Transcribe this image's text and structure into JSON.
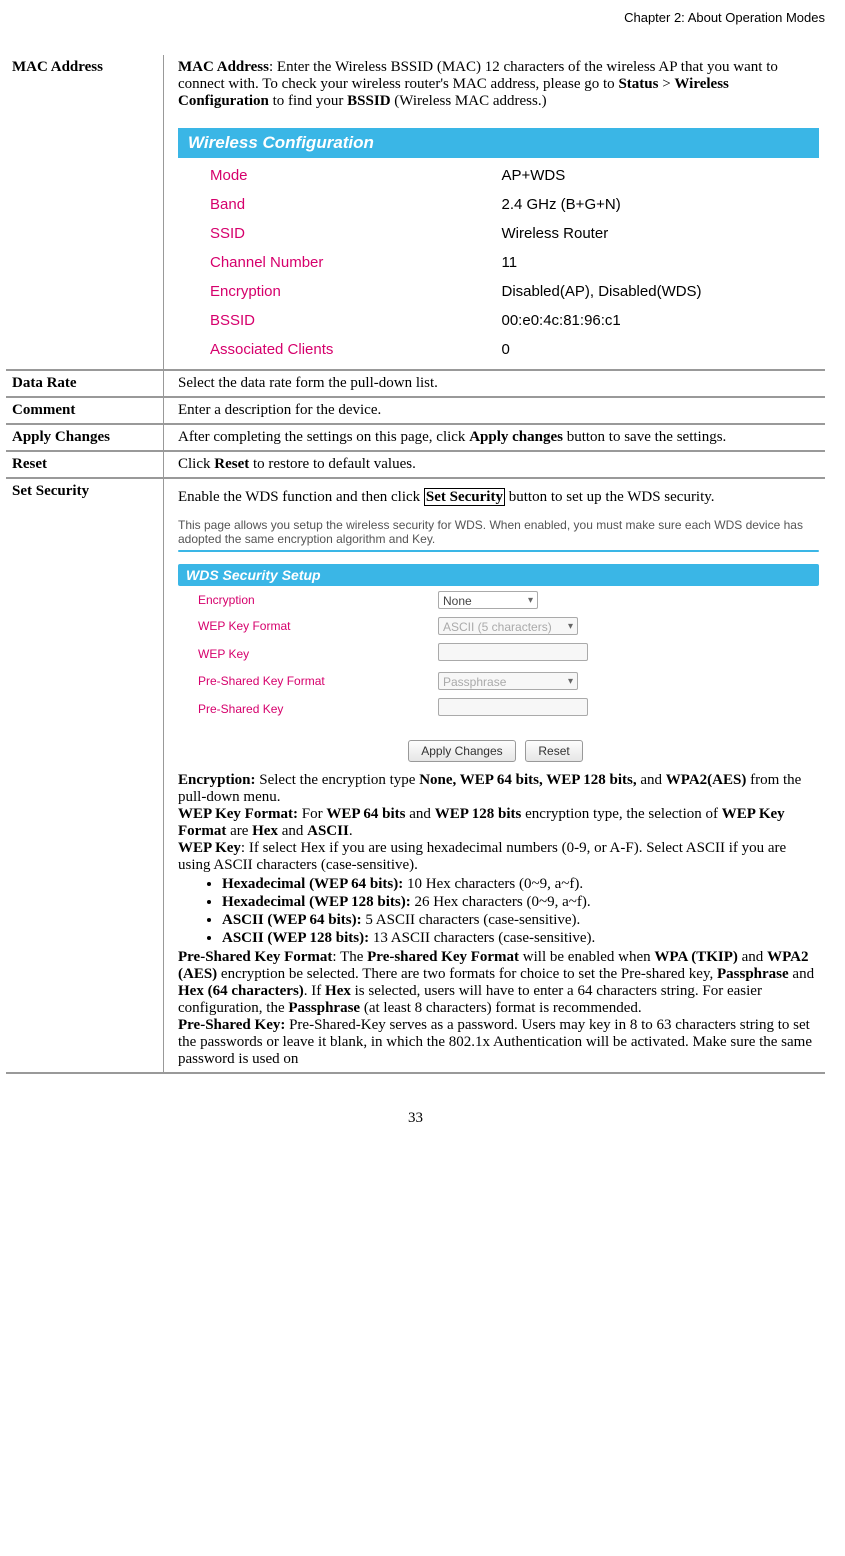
{
  "header": {
    "chapter": "Chapter 2: About Operation Modes"
  },
  "rows": {
    "mac_address": {
      "label": "MAC Address",
      "desc_pre": "MAC Address",
      "desc_1": ": Enter the Wireless BSSID (MAC) 12 characters of the wireless AP that you want to connect with. To check your wireless router's MAC address, please go to ",
      "status": "Status",
      "gt": " > ",
      "wc": "Wireless Configuration",
      "to_find": " to find your ",
      "bssid": "BSSID",
      "tail": " (Wireless MAC address.)"
    },
    "data_rate": {
      "label": "Data Rate",
      "desc": "Select the data rate form the pull-down list."
    },
    "comment": {
      "label": "Comment",
      "desc": "Enter a description for the device."
    },
    "apply": {
      "label": "Apply Changes",
      "desc_1": "After completing the settings on this page, click ",
      "btn": "Apply changes",
      "desc_2": " button to save the settings."
    },
    "reset": {
      "label": "Reset",
      "desc_1": "Click ",
      "btn": "Reset",
      "desc_2": " to restore to default values."
    },
    "set_security": {
      "label": "Set Security",
      "intro_1": "Enable the WDS function and then click ",
      "btn": "Set Security",
      "intro_2": " button to set up the WDS security.",
      "panel_text": "This page allows you setup the wireless security for WDS. When enabled, you must make sure each WDS device has adopted the same encryption algorithm and Key.",
      "enc_label": "Encryption:",
      "enc": " Select the encryption type ",
      "enc_types": "None, WEP 64 bits, WEP 128 bits,",
      "enc_and": " and ",
      "enc_wpa2": "WPA2(AES)",
      "enc_tail": " from the pull-down menu.",
      "wkf_label": "WEP Key Format:",
      "wkf_1": " For ",
      "wkf_64": "WEP 64 bits",
      "wkf_and": " and ",
      "wkf_128": "WEP 128 bits",
      "wkf_2": " encryption type, the selection of ",
      "wkf_name": "WEP Key Format",
      "wkf_3": " are ",
      "wkf_hex": "Hex",
      "wkf_4": " and ",
      "wkf_ascii": "ASCII",
      "wkf_5": ".",
      "wk_label": "WEP Key",
      "wk_1": ": If select Hex if you are using hexadecimal numbers (0-9, or A-F). Select ASCII if you are using ASCII characters (case-sensitive).",
      "b1_a": "Hexadecimal (WEP 64 bits):",
      "b1_b": " 10 Hex characters (0~9, a~f).",
      "b2_a": "Hexadecimal (WEP 128 bits):",
      "b2_b": " 26 Hex characters (0~9, a~f).",
      "b3_a": "ASCII (WEP 64 bits):",
      "b3_b": " 5 ASCII characters (case-sensitive).",
      "b4_a": "ASCII (WEP 128 bits):",
      "b4_b": " 13 ASCII characters (case-sensitive).",
      "pskf_label": "Pre-Shared Key Format",
      "pskf_1": ": The ",
      "pskf_name": "Pre-shared Key Format",
      "pskf_2": " will be enabled when ",
      "pskf_wpa": "WPA (TKIP)",
      "pskf_3": " and ",
      "pskf_wpa2": "WPA2 (AES)",
      "pskf_4": " encryption be selected. There are two formats for choice to set the Pre-shared key, ",
      "pskf_pass": "Passphrase",
      "pskf_5": " and ",
      "pskf_hex": "Hex (64 characters)",
      "pskf_6": ". If ",
      "pskf_hex2": "Hex",
      "pskf_7": " is selected, users will have to enter a 64 characters string. For easier configuration, the ",
      "pskf_pass2": "Passphrase",
      "pskf_8": " (at least 8 characters) format is recommended.",
      "psk_label": "Pre-Shared Key:",
      "psk_1": " Pre-Shared-Key serves as a password. Users may key in 8 to 63 characters string to set the passwords or leave it blank, in which the 802.1x Authentication will be activated.  Make sure the same password is used on"
    }
  },
  "wireless_config": {
    "title": "Wireless  Configuration",
    "rows": [
      {
        "k": "Mode",
        "v": "AP+WDS"
      },
      {
        "k": "Band",
        "v": "2.4 GHz (B+G+N)"
      },
      {
        "k": "SSID",
        "v": "Wireless Router"
      },
      {
        "k": "Channel Number",
        "v": "11"
      },
      {
        "k": "Encryption",
        "v": "Disabled(AP), Disabled(WDS)"
      },
      {
        "k": "BSSID",
        "v": "00:e0:4c:81:96:c1"
      },
      {
        "k": "Associated Clients",
        "v": "0"
      }
    ]
  },
  "wds_panel": {
    "title": "WDS Security Setup",
    "fields": {
      "encryption": {
        "label": "Encryption",
        "value": "None"
      },
      "wep_format": {
        "label": "WEP Key Format",
        "value": "ASCII (5 characters)"
      },
      "wep_key": {
        "label": "WEP Key",
        "value": ""
      },
      "psk_format": {
        "label": "Pre-Shared Key Format",
        "value": "Passphrase"
      },
      "psk": {
        "label": "Pre-Shared Key",
        "value": ""
      }
    },
    "buttons": {
      "apply": "Apply Changes",
      "reset": "Reset"
    }
  },
  "page_number": "33"
}
